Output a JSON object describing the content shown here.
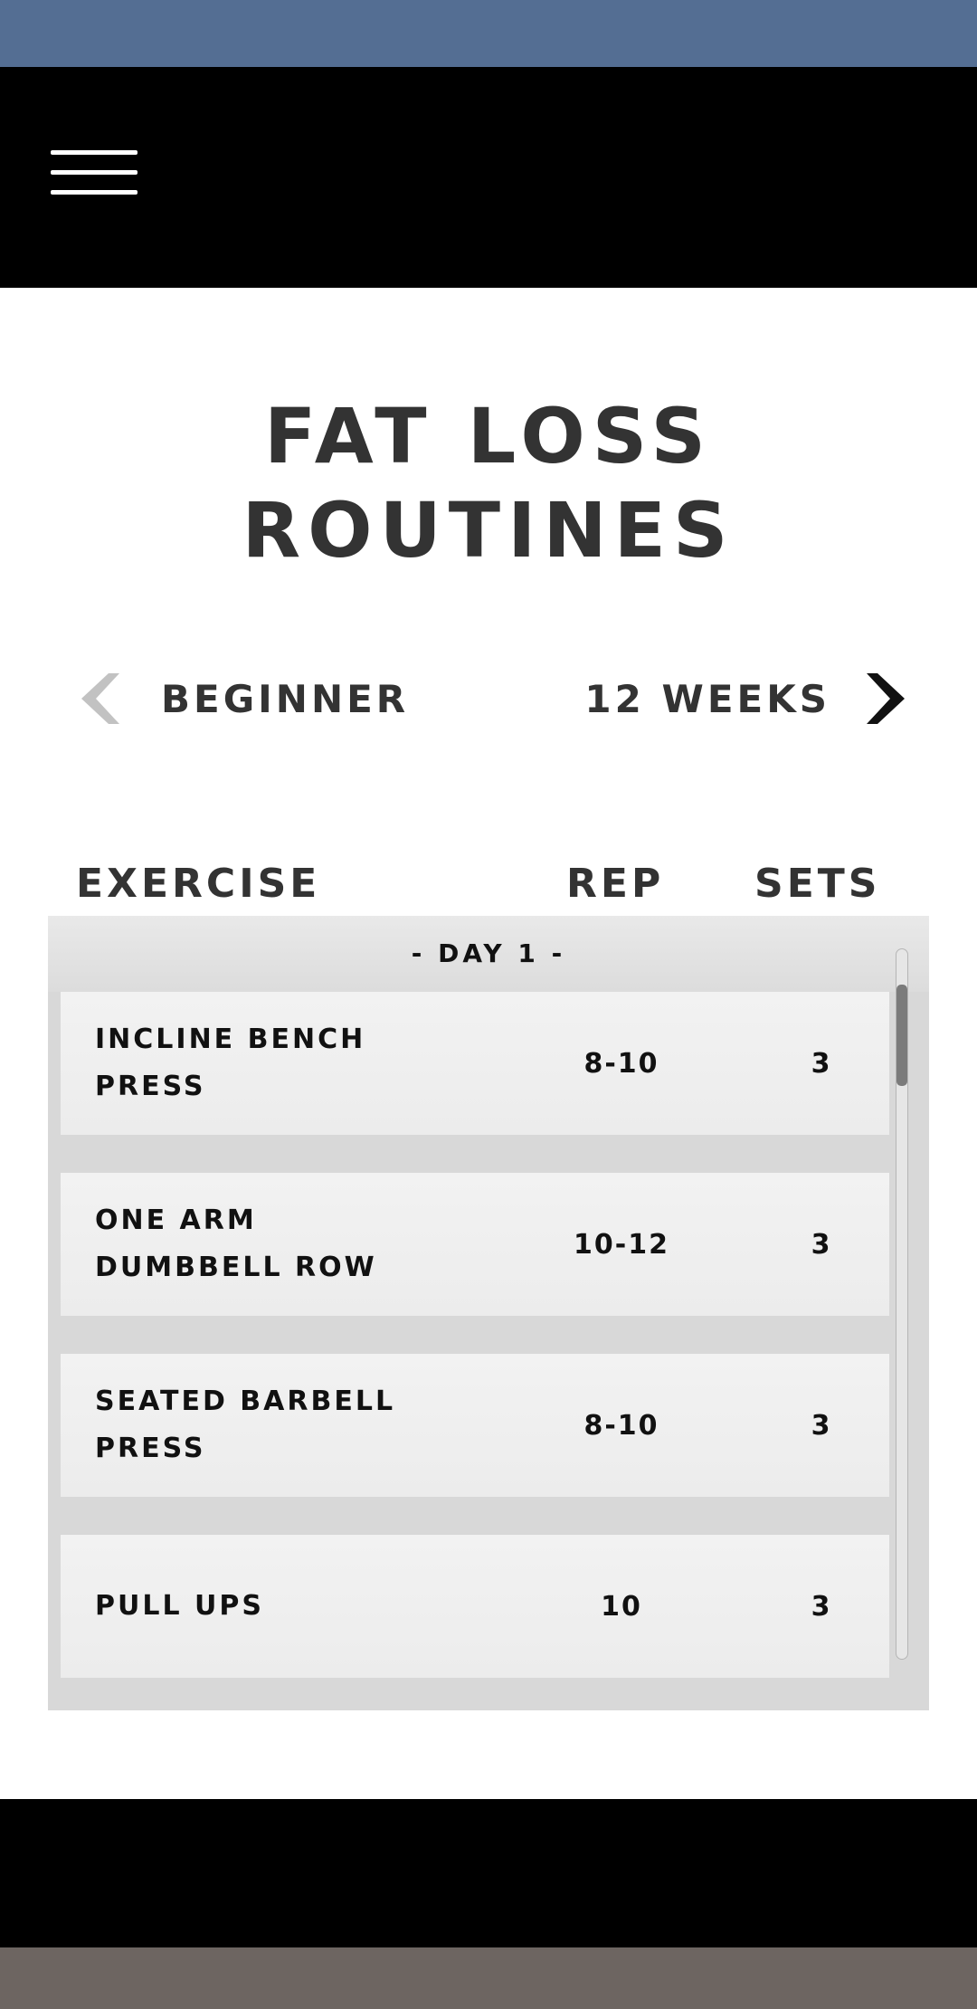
{
  "header": {
    "menu_icon": "hamburger-menu-icon"
  },
  "page": {
    "title_line1": "FAT LOSS",
    "title_line2": "ROUTINES"
  },
  "selector": {
    "level": "BEGINNER",
    "duration": "12 WEEKS",
    "prev_icon": "chevron-left-icon",
    "next_icon": "chevron-right-icon",
    "prev_color": "#c2c2c2",
    "next_color": "#111111"
  },
  "table": {
    "headers": {
      "exercise": "EXERCISE",
      "rep": "REP",
      "sets": "SETS"
    },
    "day_label": "- DAY 1 -",
    "rows": [
      {
        "exercise": "INCLINE BENCH PRESS",
        "rep": "8-10",
        "sets": "3"
      },
      {
        "exercise": "ONE ARM DUMBBELL ROW",
        "rep": "10-12",
        "sets": "3"
      },
      {
        "exercise": "SEATED BARBELL PRESS",
        "rep": "8-10",
        "sets": "3"
      },
      {
        "exercise": "PULL UPS",
        "rep": "10",
        "sets": "3"
      }
    ]
  },
  "colors": {
    "status_bar": "#546e93",
    "app_bar": "#000000",
    "title_text": "#333333",
    "panel_bg": "#d8d8d8",
    "row_bg": "#f0f0f0",
    "nav_gesture_bar": "#6d6561"
  }
}
